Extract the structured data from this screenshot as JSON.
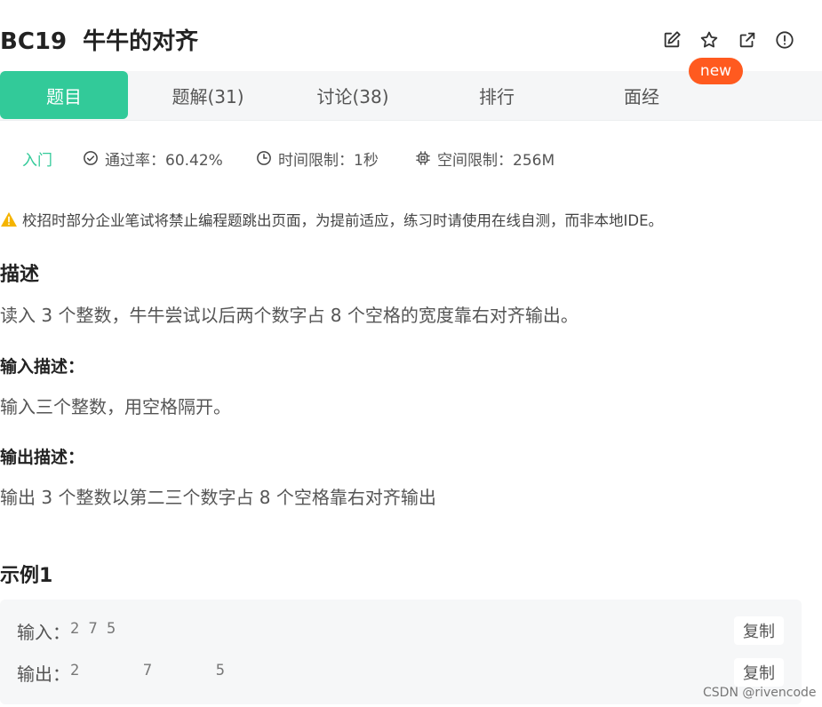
{
  "header": {
    "title": "BC19  牛牛的对齐",
    "icons": [
      "edit-icon",
      "star-icon",
      "external-link-icon",
      "report-icon"
    ]
  },
  "tabs": [
    {
      "label": "题目",
      "active": true
    },
    {
      "label": "题解(31)",
      "active": false
    },
    {
      "label": "讨论(38)",
      "active": false
    },
    {
      "label": "排行",
      "active": false
    },
    {
      "label": "面经",
      "active": false
    }
  ],
  "badge": "new",
  "meta": {
    "level": "入门",
    "pass_rate": "通过率：60.42%",
    "time_limit": "时间限制：1秒",
    "memory_limit": "空间限制：256M"
  },
  "notice": "校招时部分企业笔试将禁止编程题跳出页面，为提前适应，练习时请使用在线自测，而非本地IDE。",
  "description": {
    "heading": "描述",
    "text": "读入 3 个整数，牛牛尝试以后两个数字占 8 个空格的宽度靠右对齐输出。"
  },
  "input_desc": {
    "heading": "输入描述：",
    "text": "输入三个整数，用空格隔开。"
  },
  "output_desc": {
    "heading": "输出描述：",
    "text": "输出 3 个整数以第二三个数字占 8 个空格靠右对齐输出"
  },
  "example": {
    "heading": "示例1",
    "input_label": "输入：",
    "input_value": "2 7 5",
    "output_label": "输出：",
    "output_value": "2       7       5",
    "copy_label": "复制"
  },
  "watermark": "CSDN @rivencode",
  "colors": {
    "accent": "#32ca99",
    "badge": "#ff5a1f",
    "warning": "#f5b400"
  }
}
